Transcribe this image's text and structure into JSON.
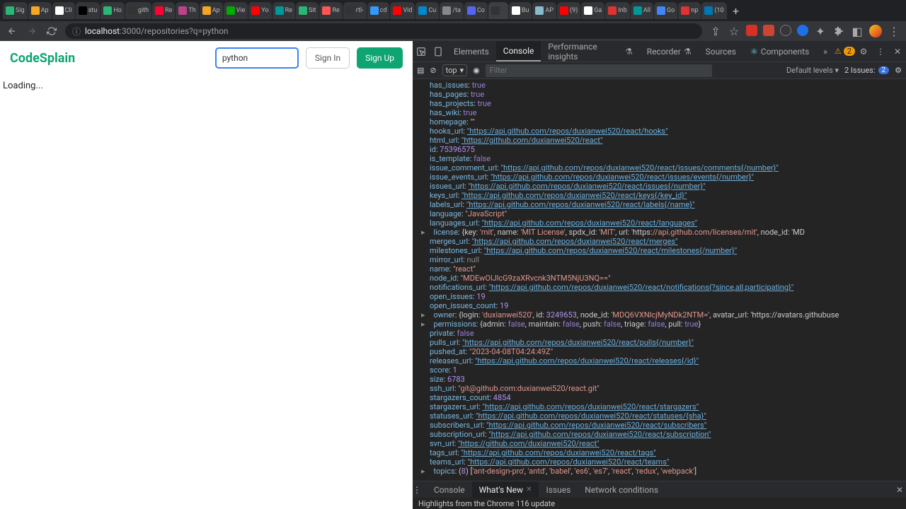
{
  "browser": {
    "tabs": [
      "Sig",
      "Ap",
      "Cli",
      "stu",
      "Ho",
      "gith",
      "Re",
      "Th",
      "Ap",
      "Vie",
      "Yo",
      "Re",
      "Sit",
      "Re",
      "rtl-",
      "cd",
      "Vid",
      "Cu",
      "/ta",
      "Co",
      "",
      "Bu",
      "AP",
      "(9)",
      "Ga",
      "Inb",
      "All",
      "Go",
      "np",
      "(10"
    ],
    "newtab": "+",
    "url_host": "localhost",
    "url_port": ":3000",
    "url_path": "/repositories?q=python"
  },
  "page": {
    "logo": "CodeSplain",
    "search_value": "python",
    "signin": "Sign In",
    "signup": "Sign Up",
    "loading": "Loading..."
  },
  "devtools": {
    "tabs": {
      "elements": "Elements",
      "console": "Console",
      "perf": "Performance insights",
      "recorder": "Recorder",
      "sources": "Sources",
      "components": "Components",
      "more": "»"
    },
    "warn_count": "2",
    "toolbar": {
      "context": "top",
      "filter": "Filter",
      "levels": "Default levels",
      "issues_label": "2 Issues:",
      "issues_count": "2"
    },
    "drawer": {
      "console": "Console",
      "whatsnew": "What's New",
      "issues": "Issues",
      "network": "Network conditions",
      "headline": "Highlights from the Chrome 116 update"
    }
  },
  "chart_data": {
    "type": "table",
    "note": "JSON-like object dump shown in DevTools console",
    "fields": [
      {
        "key": "has_issues",
        "val": "true",
        "t": "b"
      },
      {
        "key": "has_pages",
        "val": "true",
        "t": "b"
      },
      {
        "key": "has_projects",
        "val": "true",
        "t": "b"
      },
      {
        "key": "has_wiki",
        "val": "true",
        "t": "b"
      },
      {
        "key": "homepage",
        "val": "\"\"",
        "t": "s"
      },
      {
        "key": "hooks_url",
        "val": "\"https://api.github.com/repos/duxianwei520/react/hooks\"",
        "t": "u"
      },
      {
        "key": "html_url",
        "val": "\"https://github.com/duxianwei520/react\"",
        "t": "u"
      },
      {
        "key": "id",
        "val": "75396575",
        "t": "n"
      },
      {
        "key": "is_template",
        "val": "false",
        "t": "b"
      },
      {
        "key": "issue_comment_url",
        "val": "\"https://api.github.com/repos/duxianwei520/react/issues/comments{/number}\"",
        "t": "u"
      },
      {
        "key": "issue_events_url",
        "val": "\"https://api.github.com/repos/duxianwei520/react/issues/events{/number}\"",
        "t": "u"
      },
      {
        "key": "issues_url",
        "val": "\"https://api.github.com/repos/duxianwei520/react/issues{/number}\"",
        "t": "u"
      },
      {
        "key": "keys_url",
        "val": "\"https://api.github.com/repos/duxianwei520/react/keys{/key_id}\"",
        "t": "u"
      },
      {
        "key": "labels_url",
        "val": "\"https://api.github.com/repos/duxianwei520/react/labels{/name}\"",
        "t": "u"
      },
      {
        "key": "language",
        "val": "\"JavaScript\"",
        "t": "s"
      },
      {
        "key": "languages_url",
        "val": "\"https://api.github.com/repos/duxianwei520/react/languages\"",
        "t": "u"
      },
      {
        "key": "license",
        "raw": "{key: 'mit', name: 'MIT License', spdx_id: 'MIT', url: 'https://api.github.com/licenses/mit', node_id: 'MD",
        "t": "obj",
        "expand": true
      },
      {
        "key": "merges_url",
        "val": "\"https://api.github.com/repos/duxianwei520/react/merges\"",
        "t": "u"
      },
      {
        "key": "milestones_url",
        "val": "\"https://api.github.com/repos/duxianwei520/react/milestones{/number}\"",
        "t": "u"
      },
      {
        "key": "mirror_url",
        "val": "null",
        "t": "nl"
      },
      {
        "key": "name",
        "val": "\"react\"",
        "t": "s"
      },
      {
        "key": "node_id",
        "val": "\"MDEwOlJlcG9zaXRvcnk3NTM5NjU3NQ==\"",
        "t": "s"
      },
      {
        "key": "notifications_url",
        "val": "\"https://api.github.com/repos/duxianwei520/react/notifications{?since,all,participating}\"",
        "t": "u"
      },
      {
        "key": "open_issues",
        "val": "19",
        "t": "n"
      },
      {
        "key": "open_issues_count",
        "val": "19",
        "t": "n"
      },
      {
        "key": "owner",
        "raw": "{login: 'duxianwei520', id: 3249653, node_id: 'MDQ6VXNlcjMyNDk2NTM=', avatar_url: 'https://avatars.githubuse",
        "t": "obj",
        "expand": true
      },
      {
        "key": "permissions",
        "raw": "{admin: false, maintain: false, push: false, triage: false, pull: true}",
        "t": "perm",
        "expand": true
      },
      {
        "key": "private",
        "val": "false",
        "t": "b"
      },
      {
        "key": "pulls_url",
        "val": "\"https://api.github.com/repos/duxianwei520/react/pulls{/number}\"",
        "t": "u"
      },
      {
        "key": "pushed_at",
        "val": "\"2023-04-08T04:24:49Z\"",
        "t": "s"
      },
      {
        "key": "releases_url",
        "val": "\"https://api.github.com/repos/duxianwei520/react/releases{/id}\"",
        "t": "u"
      },
      {
        "key": "score",
        "val": "1",
        "t": "n"
      },
      {
        "key": "size",
        "val": "6783",
        "t": "n"
      },
      {
        "key": "ssh_url",
        "val": "\"git@github.com:duxianwei520/react.git\"",
        "t": "s"
      },
      {
        "key": "stargazers_count",
        "val": "4854",
        "t": "n"
      },
      {
        "key": "stargazers_url",
        "val": "\"https://api.github.com/repos/duxianwei520/react/stargazers\"",
        "t": "u"
      },
      {
        "key": "statuses_url",
        "val": "\"https://api.github.com/repos/duxianwei520/react/statuses/{sha}\"",
        "t": "u"
      },
      {
        "key": "subscribers_url",
        "val": "\"https://api.github.com/repos/duxianwei520/react/subscribers\"",
        "t": "u"
      },
      {
        "key": "subscription_url",
        "val": "\"https://api.github.com/repos/duxianwei520/react/subscription\"",
        "t": "u"
      },
      {
        "key": "svn_url",
        "val": "\"https://github.com/duxianwei520/react\"",
        "t": "u"
      },
      {
        "key": "tags_url",
        "val": "\"https://api.github.com/repos/duxianwei520/react/tags\"",
        "t": "u"
      },
      {
        "key": "teams_url",
        "val": "\"https://api.github.com/repos/duxianwei520/react/teams\"",
        "t": "u"
      },
      {
        "key": "topics",
        "raw": "(8) ['ant-design-pro', 'antd', 'babel', 'es6', 'es7', 'react', 'redux', 'webpack']",
        "t": "arr",
        "expand": true
      }
    ]
  }
}
